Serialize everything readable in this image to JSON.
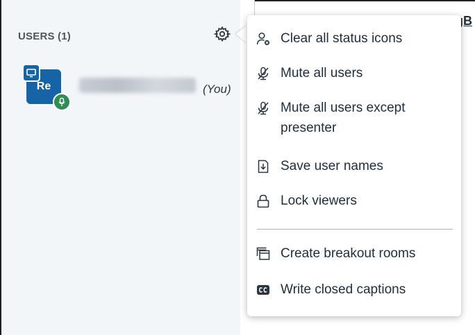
{
  "users_panel": {
    "header": "USERS (1)",
    "gear_icon": "gear-icon",
    "current_user": {
      "avatar_initials": "Re",
      "you_label": "(You)",
      "avatar_color": "#1664a6",
      "mic_badge_color": "#2f8c55"
    }
  },
  "background_peek": "gB",
  "menu": {
    "items": [
      {
        "label": "Clear all status icons",
        "icon": "user-clear-icon"
      },
      {
        "label": "Mute all users",
        "icon": "mic-off-icon"
      },
      {
        "label": "Mute all users except presenter",
        "icon": "mic-off-icon"
      },
      {
        "label": "Save user names",
        "icon": "download-file-icon"
      },
      {
        "label": "Lock viewers",
        "icon": "lock-icon"
      },
      {
        "label": "Create breakout rooms",
        "icon": "rooms-icon"
      },
      {
        "label": "Write closed captions",
        "icon": "closed-captions-icon"
      }
    ]
  }
}
